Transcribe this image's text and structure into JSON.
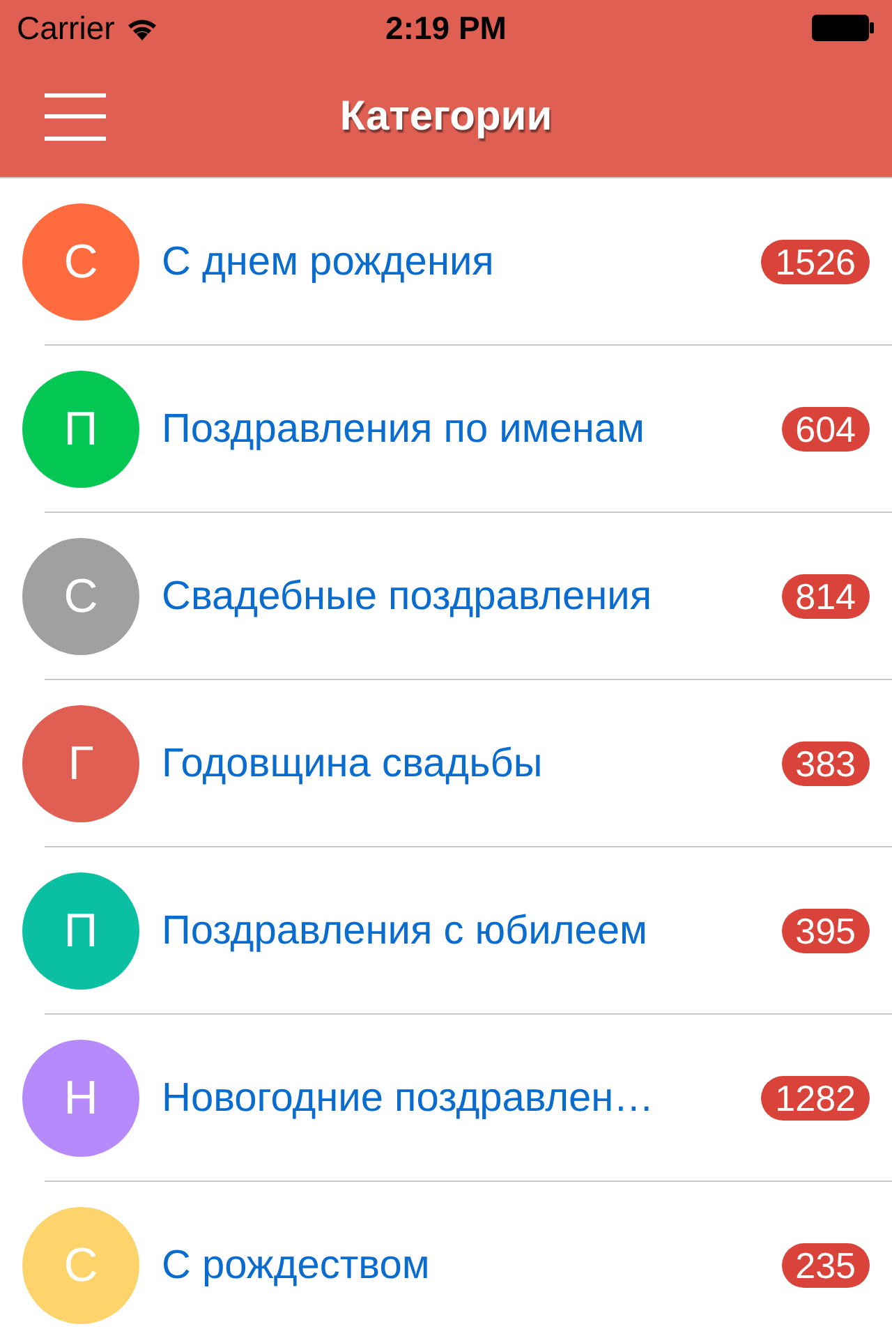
{
  "status_bar": {
    "carrier": "Carrier",
    "time": "2:19 PM"
  },
  "nav": {
    "title": "Категории"
  },
  "items": [
    {
      "initial": "С",
      "title": "С днем рождения",
      "count": "1526",
      "color": "#ff6b3f"
    },
    {
      "initial": "П",
      "title": "Поздравления по именам",
      "count": "604",
      "color": "#04c754"
    },
    {
      "initial": "С",
      "title": "Свадебные поздравления",
      "count": "814",
      "color": "#a0a0a0"
    },
    {
      "initial": "Г",
      "title": "Годовщина свадьбы",
      "count": "383",
      "color": "#e05e52"
    },
    {
      "initial": "П",
      "title": "Поздравления с юбилеем",
      "count": "395",
      "color": "#0bbfa2"
    },
    {
      "initial": "Н",
      "title": "Новогодние поздравлен…",
      "count": "1282",
      "color": "#b68afa"
    },
    {
      "initial": "С",
      "title": "С рождеством",
      "count": "235",
      "color": "#fdd46c"
    }
  ]
}
